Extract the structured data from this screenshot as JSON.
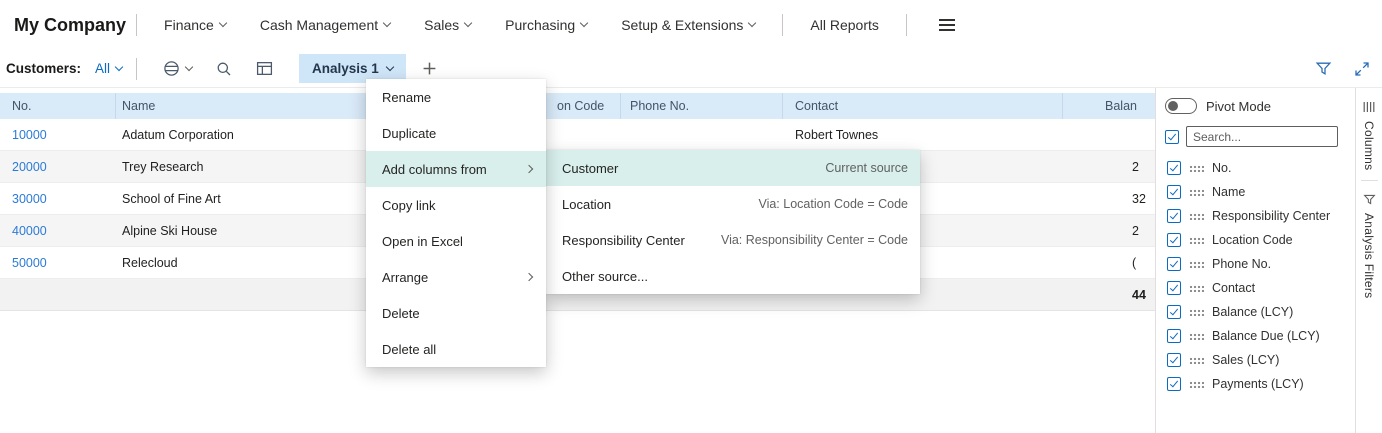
{
  "brand": {
    "company": "My Company"
  },
  "nav": {
    "items": [
      {
        "label": "Finance"
      },
      {
        "label": "Cash Management"
      },
      {
        "label": "Sales"
      },
      {
        "label": "Purchasing"
      },
      {
        "label": "Setup & Extensions"
      },
      {
        "label": "All Reports"
      }
    ]
  },
  "toolbar": {
    "page_label": "Customers:",
    "filter_all": "All",
    "analysis_tab": "Analysis 1"
  },
  "table": {
    "columns": [
      {
        "label": "No."
      },
      {
        "label": "Name"
      },
      {
        "label": "on Code"
      },
      {
        "label": "Phone No."
      },
      {
        "label": "Contact"
      },
      {
        "label": "Balan"
      }
    ],
    "rows": [
      {
        "no": "10000",
        "name": "Adatum Corporation",
        "contact": "Robert Townes",
        "balance": ""
      },
      {
        "no": "20000",
        "name": "Trey Research",
        "contact": "",
        "balance": "2"
      },
      {
        "no": "30000",
        "name": "School of Fine Art",
        "contact": "",
        "balance": "32"
      },
      {
        "no": "40000",
        "name": "Alpine Ski House",
        "contact": "",
        "balance": "2"
      },
      {
        "no": "50000",
        "name": "Relecloud",
        "contact": "",
        "balance": "("
      }
    ],
    "total": {
      "balance": "44"
    }
  },
  "context_menu": {
    "items": [
      {
        "label": "Rename"
      },
      {
        "label": "Duplicate"
      },
      {
        "label": "Add columns from"
      },
      {
        "label": "Copy link"
      },
      {
        "label": "Open in Excel"
      },
      {
        "label": "Arrange"
      },
      {
        "label": "Delete"
      },
      {
        "label": "Delete all"
      }
    ]
  },
  "submenu": {
    "items": [
      {
        "label": "Customer",
        "detail": "Current source"
      },
      {
        "label": "Location",
        "detail": "Via: Location Code = Code"
      },
      {
        "label": "Responsibility Center",
        "detail": "Via: Responsibility Center = Code"
      },
      {
        "label": "Other source...",
        "detail": ""
      }
    ]
  },
  "panel": {
    "pivot_label": "Pivot Mode",
    "search_placeholder": "Search...",
    "fields": [
      {
        "label": "No."
      },
      {
        "label": "Name"
      },
      {
        "label": "Responsibility Center"
      },
      {
        "label": "Location Code"
      },
      {
        "label": "Phone No."
      },
      {
        "label": "Contact"
      },
      {
        "label": "Balance (LCY)"
      },
      {
        "label": "Balance Due (LCY)"
      },
      {
        "label": "Sales (LCY)"
      },
      {
        "label": "Payments (LCY)"
      }
    ]
  },
  "side_tabs": {
    "columns": "Columns",
    "filters": "Analysis Filters"
  },
  "colors": {
    "accent": "#0b6bc2",
    "link": "#2b7bd6",
    "menu_highlight": "#d8efec",
    "grid_header_bg": "#d9eaf8",
    "analysis_tab_bg": "#cfe6f8"
  }
}
